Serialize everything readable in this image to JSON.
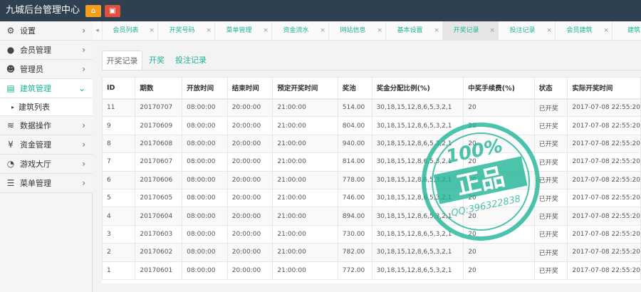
{
  "header": {
    "title": "九城后台管理中心",
    "home_icon": "⌂",
    "lock_icon": "▣"
  },
  "sidebar": {
    "items": [
      {
        "label": "设置",
        "icon": "⚙",
        "chevron": "›"
      },
      {
        "label": "会员管理",
        "icon": "●",
        "chevron": "›"
      },
      {
        "label": "管理员",
        "icon": "☻",
        "chevron": "›"
      },
      {
        "label": "建筑管理",
        "icon": "▤",
        "chevron": "⌄"
      },
      {
        "label": "数据操作",
        "icon": "≋",
        "chevron": "›"
      },
      {
        "label": "资金管理",
        "icon": "¥",
        "chevron": "›"
      },
      {
        "label": "游戏大厅",
        "icon": "◔",
        "chevron": "›"
      },
      {
        "label": "菜单管理",
        "icon": "☰",
        "chevron": "›"
      }
    ],
    "sub_items": [
      {
        "label": "建筑列表",
        "bullet": "▸"
      }
    ]
  },
  "tabbar": {
    "scroll_left": "◂",
    "tabs": [
      {
        "label": "会员列表",
        "close": "×"
      },
      {
        "label": "开奖号码",
        "close": "×"
      },
      {
        "label": "菜单管理",
        "close": "×"
      },
      {
        "label": "资金流水",
        "close": "×"
      },
      {
        "label": "网站信息",
        "close": "×"
      },
      {
        "label": "基本设置",
        "close": "×"
      },
      {
        "label": "开奖记录",
        "close": "×"
      },
      {
        "label": "投注记录",
        "close": "×"
      },
      {
        "label": "会员建筑",
        "close": "×"
      },
      {
        "label": "建筑",
        "close": ""
      }
    ]
  },
  "subtabs": [
    "开奖记录",
    "开奖",
    "投注记录"
  ],
  "table": {
    "columns": [
      "ID",
      "期数",
      "开放时间",
      "结束时间",
      "预定开奖时间",
      "奖池",
      "奖金分配比例(%)",
      "中奖手续费(%)",
      "状态",
      "实际开奖时间"
    ],
    "rows": [
      [
        "11",
        "20170707",
        "08:00:00",
        "20:00:00",
        "21:00:00",
        "514.00",
        "30,18,15,12,8,6,5,3,2,1",
        "20",
        "已开奖",
        "2017-07-08 22:55:20"
      ],
      [
        "9",
        "20170609",
        "08:00:00",
        "20:00:00",
        "21:00:00",
        "804.00",
        "30,18,15,12,8,6,5,3,2,1",
        "20",
        "已开奖",
        "2017-07-08 22:55:20"
      ],
      [
        "8",
        "20170608",
        "08:00:00",
        "20:00:00",
        "21:00:00",
        "940.00",
        "30,18,15,12,8,6,5,3,2,1",
        "20",
        "已开奖",
        "2017-07-08 22:55:20"
      ],
      [
        "7",
        "20170607",
        "08:00:00",
        "20:00:00",
        "21:00:00",
        "814.00",
        "30,18,15,12,8,6,5,3,2,1",
        "20",
        "已开奖",
        "2017-07-08 22:55:20"
      ],
      [
        "6",
        "20170606",
        "08:00:00",
        "20:00:00",
        "21:00:00",
        "778.00",
        "30,18,15,12,8,6,5,3,2,1",
        "20",
        "已开奖",
        "2017-07-08 22:55:20"
      ],
      [
        "5",
        "20170605",
        "08:00:00",
        "20:00:00",
        "21:00:00",
        "746.00",
        "30,18,15,12,8,6,5,3,2,1",
        "20",
        "已开奖",
        "2017-07-08 22:55:20"
      ],
      [
        "4",
        "20170604",
        "08:00:00",
        "20:00:00",
        "21:00:00",
        "894.00",
        "30,18,15,12,8,6,5,3,2,1",
        "20",
        "已开奖",
        "2017-07-08 22:55:20"
      ],
      [
        "3",
        "20170603",
        "08:00:00",
        "20:00:00",
        "21:00:00",
        "730.00",
        "30,18,15,12,8,6,5,3,2,1",
        "20",
        "已开奖",
        "2017-07-08 22:55:20"
      ],
      [
        "2",
        "20170602",
        "08:00:00",
        "20:00:00",
        "21:00:00",
        "782.00",
        "30,18,15,12,8,6,5,3,2,1",
        "20",
        "已开奖",
        "2017-07-08 22:55:20"
      ],
      [
        "1",
        "20170601",
        "08:00:00",
        "20:00:00",
        "21:00:00",
        "772.00",
        "30,18,15,12,8,6,5,3,2,1",
        "20",
        "已开奖",
        "2017-07-08 22:55:20"
      ]
    ]
  },
  "watermark": {
    "percent": "100%",
    "main": "正品",
    "contact": "QQ:396322838",
    "color": "#1ab394"
  },
  "theme": {
    "accent": "#1ab394",
    "header_bg": "#2f4050"
  }
}
